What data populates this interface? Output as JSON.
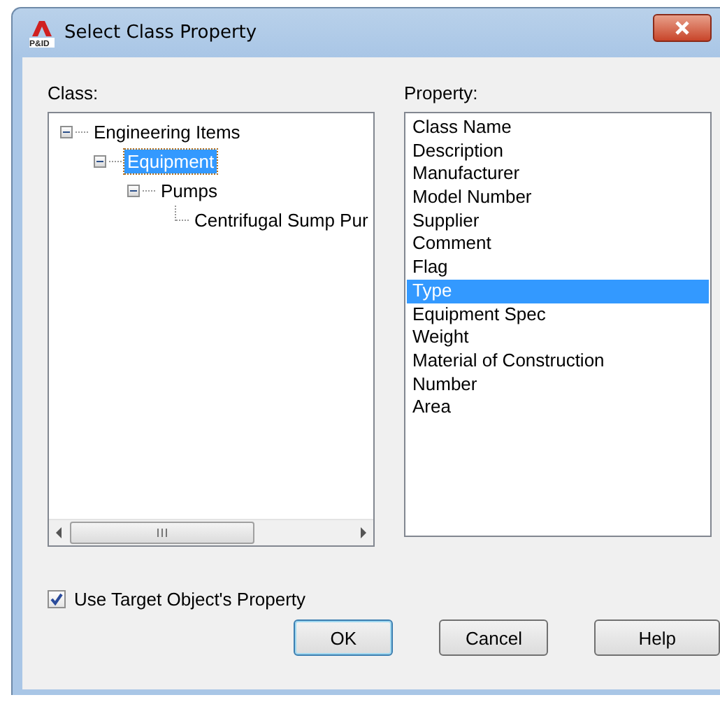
{
  "window": {
    "logo_text": "P&ID",
    "title": "Select Class Property"
  },
  "class_panel": {
    "label": "Class:",
    "tree": [
      {
        "label": "Engineering Items",
        "expanded": true,
        "selected": false,
        "children": [
          {
            "label": "Equipment",
            "expanded": true,
            "selected": true,
            "children": [
              {
                "label": "Pumps",
                "expanded": true,
                "selected": false,
                "children": [
                  {
                    "label": "Centrifugal Sump Pur",
                    "selected": false
                  }
                ]
              }
            ]
          }
        ]
      }
    ]
  },
  "property_panel": {
    "label": "Property:",
    "items": [
      {
        "label": "Class Name",
        "selected": false
      },
      {
        "label": "Description",
        "selected": false
      },
      {
        "label": "Manufacturer",
        "selected": false
      },
      {
        "label": "Model Number",
        "selected": false
      },
      {
        "label": "Supplier",
        "selected": false
      },
      {
        "label": "Comment",
        "selected": false
      },
      {
        "label": "Flag",
        "selected": false
      },
      {
        "label": "Type",
        "selected": true
      },
      {
        "label": "Equipment Spec",
        "selected": false
      },
      {
        "label": "Weight",
        "selected": false
      },
      {
        "label": "Material of Construction",
        "selected": false
      },
      {
        "label": "Number",
        "selected": false
      },
      {
        "label": "Area",
        "selected": false
      }
    ]
  },
  "use_target_property": {
    "label": "Use Target Object's Property",
    "checked": true
  },
  "buttons": [
    {
      "label": "OK",
      "default": true
    },
    {
      "label": "Cancel",
      "default": false
    },
    {
      "label": "Help",
      "default": false
    }
  ]
}
